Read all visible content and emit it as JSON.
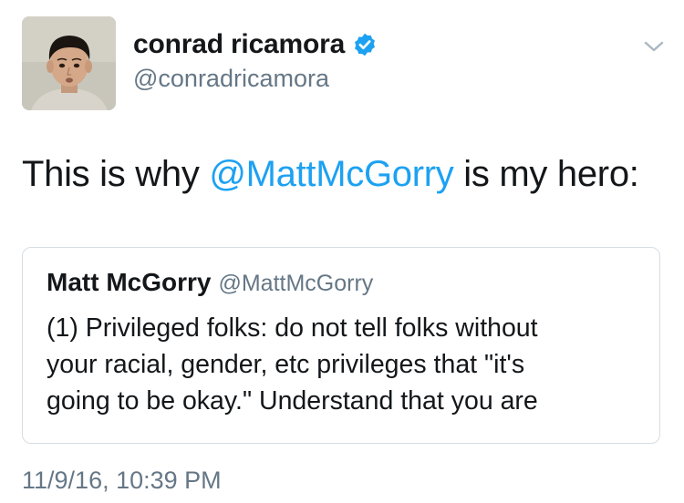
{
  "author": {
    "display_name": "conrad ricamora",
    "handle": "@conradricamora",
    "verified": true,
    "avatar_icon": "profile-photo"
  },
  "tweet": {
    "text_before": "This is why ",
    "mention": "@MattMcGorry",
    "text_after": " is my hero:",
    "timestamp": "11/9/16, 10:39 PM"
  },
  "quoted_tweet": {
    "display_name": "Matt McGorry",
    "handle": "@MattMcGorry",
    "lines": [
      "(1) Privileged folks: do not tell folks without",
      "your racial, gender, etc privileges that \"it's",
      "going to be okay.\" Understand that you are"
    ]
  },
  "colors": {
    "link": "#1da1f2",
    "secondary_text": "#657786",
    "verified_badge": "#1da1f2",
    "card_border": "#d6dde3"
  },
  "icons": {
    "menu": "chevron-down-icon",
    "verified": "verified-badge-icon"
  }
}
